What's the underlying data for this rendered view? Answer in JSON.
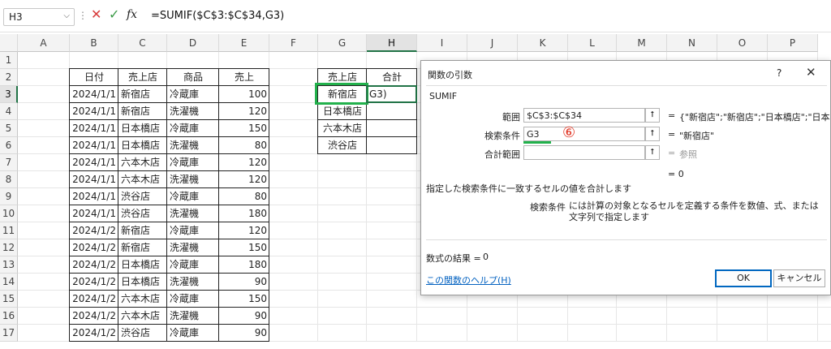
{
  "formula_bar": {
    "cell_ref": "H3",
    "formula": "=SUMIF($C$3:$C$34,G3)",
    "cancel_icon": "✕",
    "enter_icon": "✓",
    "fx_label": "fx"
  },
  "columns": [
    "A",
    "B",
    "C",
    "D",
    "E",
    "F",
    "G",
    "H",
    "I",
    "J",
    "K",
    "L",
    "M",
    "N",
    "O",
    "P"
  ],
  "rows": [
    "1",
    "2",
    "3",
    "4",
    "5",
    "6",
    "7",
    "8",
    "9",
    "10",
    "11",
    "12",
    "13",
    "14",
    "15",
    "16",
    "17"
  ],
  "table": {
    "headers": [
      "日付",
      "売上店",
      "商品",
      "売上"
    ],
    "rows": [
      [
        "2024/1/1",
        "新宿店",
        "冷蔵庫",
        "100"
      ],
      [
        "2024/1/1",
        "新宿店",
        "洗濯機",
        "120"
      ],
      [
        "2024/1/1",
        "日本橋店",
        "冷蔵庫",
        "150"
      ],
      [
        "2024/1/1",
        "日本橋店",
        "洗濯機",
        "80"
      ],
      [
        "2024/1/1",
        "六本木店",
        "冷蔵庫",
        "120"
      ],
      [
        "2024/1/1",
        "六本木店",
        "洗濯機",
        "120"
      ],
      [
        "2024/1/1",
        "渋谷店",
        "冷蔵庫",
        "80"
      ],
      [
        "2024/1/1",
        "渋谷店",
        "洗濯機",
        "180"
      ],
      [
        "2024/1/2",
        "新宿店",
        "冷蔵庫",
        "120"
      ],
      [
        "2024/1/2",
        "新宿店",
        "洗濯機",
        "150"
      ],
      [
        "2024/1/2",
        "日本橋店",
        "冷蔵庫",
        "180"
      ],
      [
        "2024/1/2",
        "日本橋店",
        "洗濯機",
        "90"
      ],
      [
        "2024/1/2",
        "六本木店",
        "冷蔵庫",
        "150"
      ],
      [
        "2024/1/2",
        "六本木店",
        "洗濯機",
        "90"
      ],
      [
        "2024/1/2",
        "渋谷店",
        "冷蔵庫",
        "90"
      ]
    ]
  },
  "summary": {
    "headers": [
      "売上店",
      "合計"
    ],
    "stores": [
      "新宿店",
      "日本橋店",
      "六本木店",
      "渋谷店"
    ],
    "h3_value": "G3)"
  },
  "dialog": {
    "title": "関数の引数",
    "help_q": "?",
    "close": "✕",
    "function_name": "SUMIF",
    "args": [
      {
        "label": "範囲",
        "value": "$C$3:$C$34",
        "result": "{\"新宿店\";\"新宿店\";\"日本橋店\";\"日本"
      },
      {
        "label": "検索条件",
        "value": "G3",
        "result": "\"新宿店\""
      },
      {
        "label": "合計範囲",
        "value": "",
        "result": "参照"
      }
    ],
    "equals": "=",
    "total_result": "= 0",
    "description": "指定した検索条件に一致するセルの値を合計します",
    "param_name": "検索条件",
    "param_desc": "には計算の対象となるセルを定義する条件を数値、式、または文字列で指定します",
    "formula_result_label": "数式の結果 =",
    "formula_result_value": "0",
    "help_link": "この関数のヘルプ(H)",
    "ok": "OK",
    "cancel": "キャンセル",
    "step_marker": "⑥"
  },
  "colors": {
    "highlight_green": "#22b14c",
    "step_red": "#e0301e",
    "link_blue": "#0563c1"
  }
}
